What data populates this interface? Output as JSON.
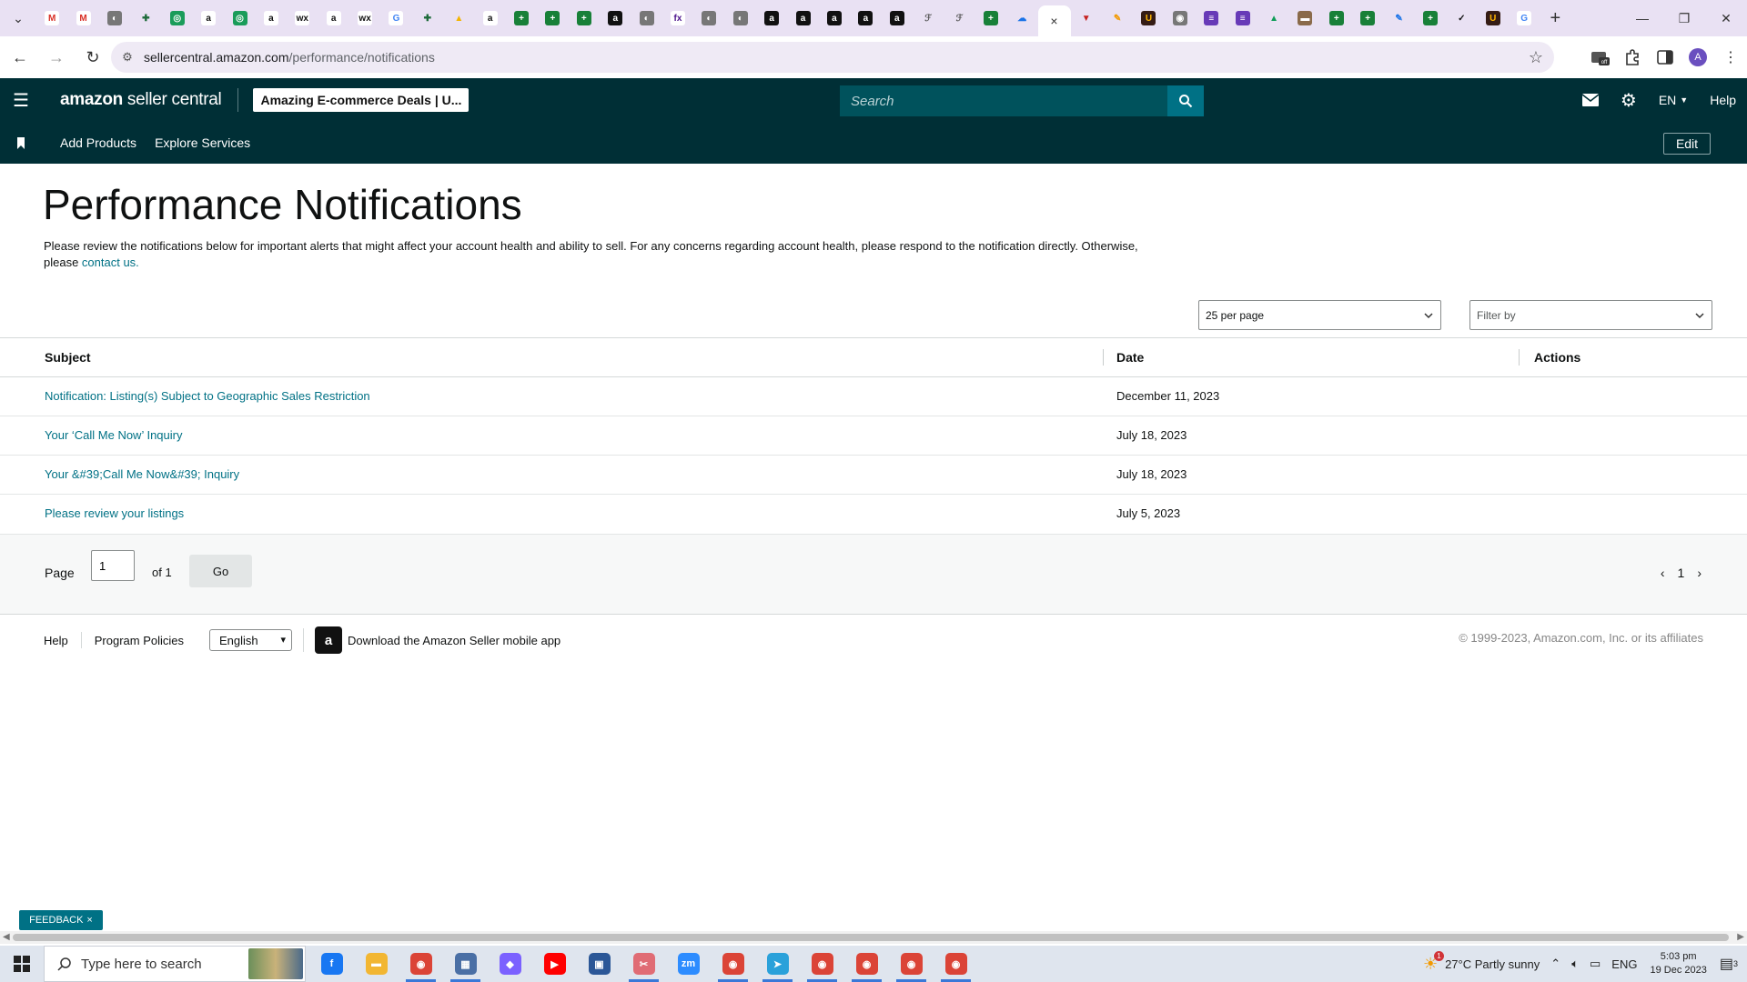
{
  "browser": {
    "tabs": [
      {
        "icon": "gmail-icon",
        "color": "#ffffff",
        "glyph": "M",
        "fg": "#d93025"
      },
      {
        "icon": "gmail-icon",
        "color": "#ffffff",
        "glyph": "M",
        "fg": "#d93025"
      },
      {
        "icon": "globe-icon",
        "color": "#777777",
        "glyph": "◐",
        "fg": "#ffffff"
      },
      {
        "icon": "puzzle-icon",
        "color": "#e9e1f3",
        "glyph": "✚",
        "fg": "#1e6b3a"
      },
      {
        "icon": "green-circle-icon",
        "color": "#1a9c5a",
        "glyph": "◎",
        "fg": "#ffffff"
      },
      {
        "icon": "amazon-icon",
        "color": "#ffffff",
        "glyph": "a",
        "fg": "#111111"
      },
      {
        "icon": "green-circle-icon",
        "color": "#1a9c5a",
        "glyph": "◎",
        "fg": "#ffffff"
      },
      {
        "icon": "amazon-icon",
        "color": "#ffffff",
        "glyph": "a",
        "fg": "#111111"
      },
      {
        "icon": "wix-icon",
        "color": "#ffffff",
        "glyph": "wx",
        "fg": "#111111"
      },
      {
        "icon": "amazon-icon",
        "color": "#ffffff",
        "glyph": "a",
        "fg": "#111111"
      },
      {
        "icon": "wix-icon",
        "color": "#ffffff",
        "glyph": "wx",
        "fg": "#111111"
      },
      {
        "icon": "google-icon",
        "color": "#ffffff",
        "glyph": "G",
        "fg": "#4285f4"
      },
      {
        "icon": "puzzle-icon",
        "color": "#e9e1f3",
        "glyph": "✚",
        "fg": "#1e6b3a"
      },
      {
        "icon": "drive-icon",
        "color": "#e9e1f3",
        "glyph": "▲",
        "fg": "#f4b400"
      },
      {
        "icon": "amazon-icon",
        "color": "#ffffff",
        "glyph": "a",
        "fg": "#111111"
      },
      {
        "icon": "sheets-icon",
        "color": "#188038",
        "glyph": "+",
        "fg": "#ffffff"
      },
      {
        "icon": "sheets-icon",
        "color": "#188038",
        "glyph": "+",
        "fg": "#ffffff"
      },
      {
        "icon": "sheets-icon",
        "color": "#188038",
        "glyph": "+",
        "fg": "#ffffff"
      },
      {
        "icon": "amazon-icon",
        "color": "#111111",
        "glyph": "a",
        "fg": "#ffffff"
      },
      {
        "icon": "globe-icon",
        "color": "#777777",
        "glyph": "◐",
        "fg": "#ffffff"
      },
      {
        "icon": "fedex-icon",
        "color": "#ffffff",
        "glyph": "fx",
        "fg": "#4d148c"
      },
      {
        "icon": "globe-icon",
        "color": "#777777",
        "glyph": "◐",
        "fg": "#ffffff"
      },
      {
        "icon": "globe-icon",
        "color": "#777777",
        "glyph": "◐",
        "fg": "#ffffff"
      },
      {
        "icon": "amazon-icon",
        "color": "#111111",
        "glyph": "a",
        "fg": "#ffffff"
      },
      {
        "icon": "amazon-icon",
        "color": "#111111",
        "glyph": "a",
        "fg": "#ffffff"
      },
      {
        "icon": "amazon-icon",
        "color": "#111111",
        "glyph": "a",
        "fg": "#ffffff"
      },
      {
        "icon": "amazon-icon",
        "color": "#111111",
        "glyph": "a",
        "fg": "#ffffff"
      },
      {
        "icon": "amazon-icon",
        "color": "#111111",
        "glyph": "a",
        "fg": "#ffffff"
      },
      {
        "icon": "script-icon",
        "color": "#e9e1f3",
        "glyph": "ℱ",
        "fg": "#555555"
      },
      {
        "icon": "script-icon",
        "color": "#e9e1f3",
        "glyph": "ℱ",
        "fg": "#555555"
      },
      {
        "icon": "sheets-icon",
        "color": "#188038",
        "glyph": "+",
        "fg": "#ffffff"
      },
      {
        "icon": "cloud-icon",
        "color": "#e9e1f3",
        "glyph": "☁",
        "fg": "#1a73e8"
      }
    ],
    "active_tab_close": "×",
    "tabs_after": [
      {
        "icon": "vpn-icon",
        "color": "#e9e1f3",
        "glyph": "▼",
        "fg": "#c5221f"
      },
      {
        "icon": "pen-icon",
        "color": "#e9e1f3",
        "glyph": "✎",
        "fg": "#f29900"
      },
      {
        "icon": "ups-icon",
        "color": "#351c15",
        "glyph": "U",
        "fg": "#ffb500"
      },
      {
        "icon": "disc-icon",
        "color": "#777777",
        "glyph": "◉",
        "fg": "#ffffff"
      },
      {
        "icon": "forms-icon",
        "color": "#673ab7",
        "glyph": "≡",
        "fg": "#ffffff"
      },
      {
        "icon": "forms-icon",
        "color": "#673ab7",
        "glyph": "≡",
        "fg": "#ffffff"
      },
      {
        "icon": "drive-icon",
        "color": "#e9e1f3",
        "glyph": "▲",
        "fg": "#0f9d58"
      },
      {
        "icon": "photo-icon",
        "color": "#8a6a4a",
        "glyph": "▬",
        "fg": "#ffffff"
      },
      {
        "icon": "sheets-icon",
        "color": "#188038",
        "glyph": "+",
        "fg": "#ffffff"
      },
      {
        "icon": "sheets-icon",
        "color": "#188038",
        "glyph": "+",
        "fg": "#ffffff"
      },
      {
        "icon": "pen-icon",
        "color": "#e9e1f3",
        "glyph": "✎",
        "fg": "#1a73e8"
      },
      {
        "icon": "sheets-icon",
        "color": "#188038",
        "glyph": "+",
        "fg": "#ffffff"
      },
      {
        "icon": "check-icon",
        "color": "#e9e1f3",
        "glyph": "✓",
        "fg": "#111111"
      },
      {
        "icon": "ups-icon",
        "color": "#351c15",
        "glyph": "U",
        "fg": "#ffb500"
      },
      {
        "icon": "google-icon",
        "color": "#ffffff",
        "glyph": "G",
        "fg": "#4285f4"
      }
    ],
    "new_tab": "+",
    "url_host": "sellercentral.amazon.com",
    "url_path": "/performance/notifications"
  },
  "header": {
    "logo_bold": "amazon",
    "logo_rest": " seller central",
    "store_name": "Amazing E-commerce Deals | U...",
    "search_placeholder": "Search",
    "language": "EN",
    "help": "Help"
  },
  "nav": {
    "links": [
      "Add Products",
      "Explore Services"
    ],
    "edit": "Edit"
  },
  "main": {
    "title": "Performance Notifications",
    "intro_text": "Please review the notifications below for important alerts that might affect your account health and ability to sell. For any concerns regarding account health, please respond to the notification directly. Otherwise, please ",
    "intro_link": "contact us.",
    "per_page": "25 per page",
    "filter_placeholder": "Filter by"
  },
  "table": {
    "headers": {
      "subject": "Subject",
      "date": "Date",
      "actions": "Actions"
    },
    "rows": [
      {
        "subject": "Notification: Listing(s) Subject to Geographic Sales Restriction",
        "date": "December 11, 2023"
      },
      {
        "subject": "Your ‘Call Me Now’ Inquiry",
        "date": "July 18, 2023"
      },
      {
        "subject": "Your &#39;Call Me Now&#39; Inquiry",
        "date": "July 18, 2023"
      },
      {
        "subject": "Please review your listings",
        "date": "July 5, 2023"
      }
    ]
  },
  "pagination": {
    "page_label": "Page",
    "page_value": "1",
    "of_label": "of 1",
    "go_label": "Go",
    "current_page": "1"
  },
  "footer": {
    "help": "Help",
    "policies": "Program Policies",
    "language": "English",
    "app_text": "Download the Amazon Seller mobile app",
    "copyright": "© 1999-2023, Amazon.com, Inc. or its affiliates"
  },
  "feedback": {
    "label": "FEEDBACK"
  },
  "taskbar": {
    "search_placeholder": "Type here to search",
    "weather": "27°C  Partly sunny",
    "weather_badge": "1",
    "lang": "ENG",
    "time": "5:03 pm",
    "date": "19 Dec 2023",
    "notif_count": "3",
    "apps": [
      {
        "icon": "facebook-icon",
        "color": "#1877f2",
        "glyph": "f"
      },
      {
        "icon": "folder-icon",
        "color": "#f2b632",
        "glyph": "▬"
      },
      {
        "icon": "chrome-icon",
        "color": "#db4437",
        "glyph": "◉",
        "active": true
      },
      {
        "icon": "calculator-icon",
        "color": "#4a6fa5",
        "glyph": "▦",
        "active": true
      },
      {
        "icon": "copilot-icon",
        "color": "#7b61ff",
        "glyph": "◆"
      },
      {
        "icon": "youtube-icon",
        "color": "#ff0000",
        "glyph": "▶"
      },
      {
        "icon": "store-icon",
        "color": "#2b5797",
        "glyph": "▣"
      },
      {
        "icon": "snipping-icon",
        "color": "#e06c75",
        "glyph": "✂",
        "active": true
      },
      {
        "icon": "zoom-icon",
        "color": "#2d8cff",
        "glyph": "zm"
      },
      {
        "icon": "chrome-icon",
        "color": "#db4437",
        "glyph": "◉",
        "active": true
      },
      {
        "icon": "telegram-icon",
        "color": "#2aa1da",
        "glyph": "➤",
        "active": true
      },
      {
        "icon": "chrome-icon",
        "color": "#db4437",
        "glyph": "◉",
        "active": true
      },
      {
        "icon": "chrome-icon",
        "color": "#db4437",
        "glyph": "◉",
        "active": true
      },
      {
        "icon": "chrome-icon",
        "color": "#db4437",
        "glyph": "◉",
        "active": true
      },
      {
        "icon": "chrome-icon",
        "color": "#db4437",
        "glyph": "◉",
        "active": true
      }
    ]
  }
}
